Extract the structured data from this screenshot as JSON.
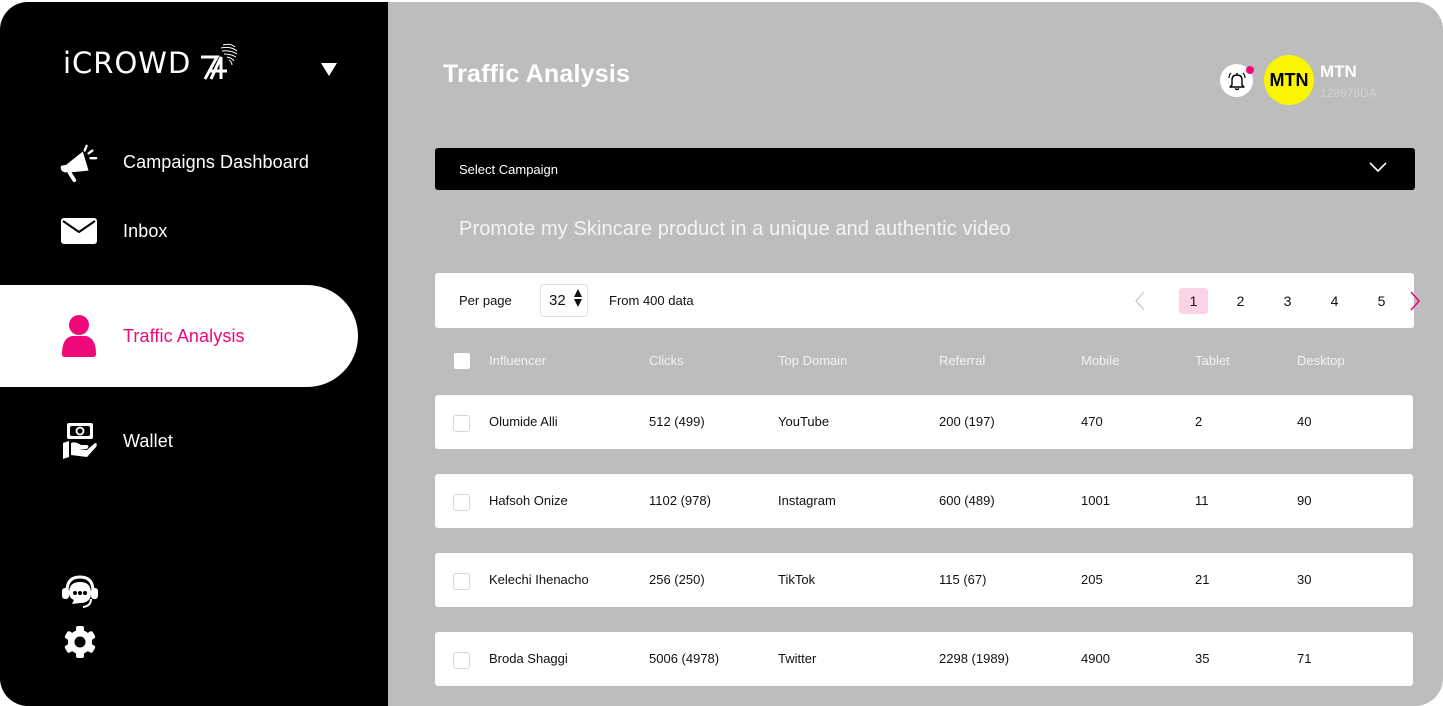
{
  "app": {
    "logo_text": "iCROWD",
    "logo_suffix": "A"
  },
  "sidebar": {
    "items": [
      {
        "label": "Campaigns Dashboard",
        "icon": "megaphone-icon",
        "active": false
      },
      {
        "label": "Inbox",
        "icon": "envelope-icon",
        "active": false
      },
      {
        "label": "Traffic Analysis",
        "icon": "user-icon",
        "active": true
      },
      {
        "label": "Wallet",
        "icon": "wallet-hand-icon",
        "active": false
      }
    ],
    "bottom_icons": [
      "support-chat-icon",
      "gear-icon"
    ]
  },
  "header": {
    "title": "Traffic Analysis",
    "user": {
      "avatar_text": "MTN",
      "name": "MTN",
      "id": "128978DA"
    },
    "notification_dot": true
  },
  "campaign": {
    "select_label": "Select Campaign",
    "description": "Promote my Skincare product in a unique and authentic video"
  },
  "pager": {
    "per_page_label": "Per page",
    "per_page_value": "32",
    "from_data": "From 400 data",
    "pages": [
      "1",
      "2",
      "3",
      "4",
      "5"
    ],
    "current_page": "1"
  },
  "table": {
    "columns": [
      "Influencer",
      "Clicks",
      "Top Domain",
      "Referral",
      "Mobile",
      "Tablet",
      "Desktop"
    ],
    "rows": [
      {
        "influencer": "Olumide Alli",
        "clicks": "512 (499)",
        "top_domain": "YouTube",
        "referral": "200 (197)",
        "mobile": "470",
        "tablet": "2",
        "desktop": "40"
      },
      {
        "influencer": "Hafsoh Onize",
        "clicks": "1102 (978)",
        "top_domain": "Instagram",
        "referral": "600 (489)",
        "mobile": "1001",
        "tablet": "11",
        "desktop": "90"
      },
      {
        "influencer": "Kelechi Ihenacho",
        "clicks": "256 (250)",
        "top_domain": "TikTok",
        "referral": "115 (67)",
        "mobile": "205",
        "tablet": "21",
        "desktop": "30"
      },
      {
        "influencer": "Broda Shaggi",
        "clicks": "5006 (4978)",
        "top_domain": "Twitter",
        "referral": "2298 (1989)",
        "mobile": "4900",
        "tablet": "35",
        "desktop": "71"
      }
    ]
  },
  "colors": {
    "accent": "#f0087a",
    "sidebar_bg": "#000000",
    "main_bg": "#bdbdbd",
    "avatar_bg": "#fbf500",
    "active_page_bg": "#fbd3e6"
  }
}
